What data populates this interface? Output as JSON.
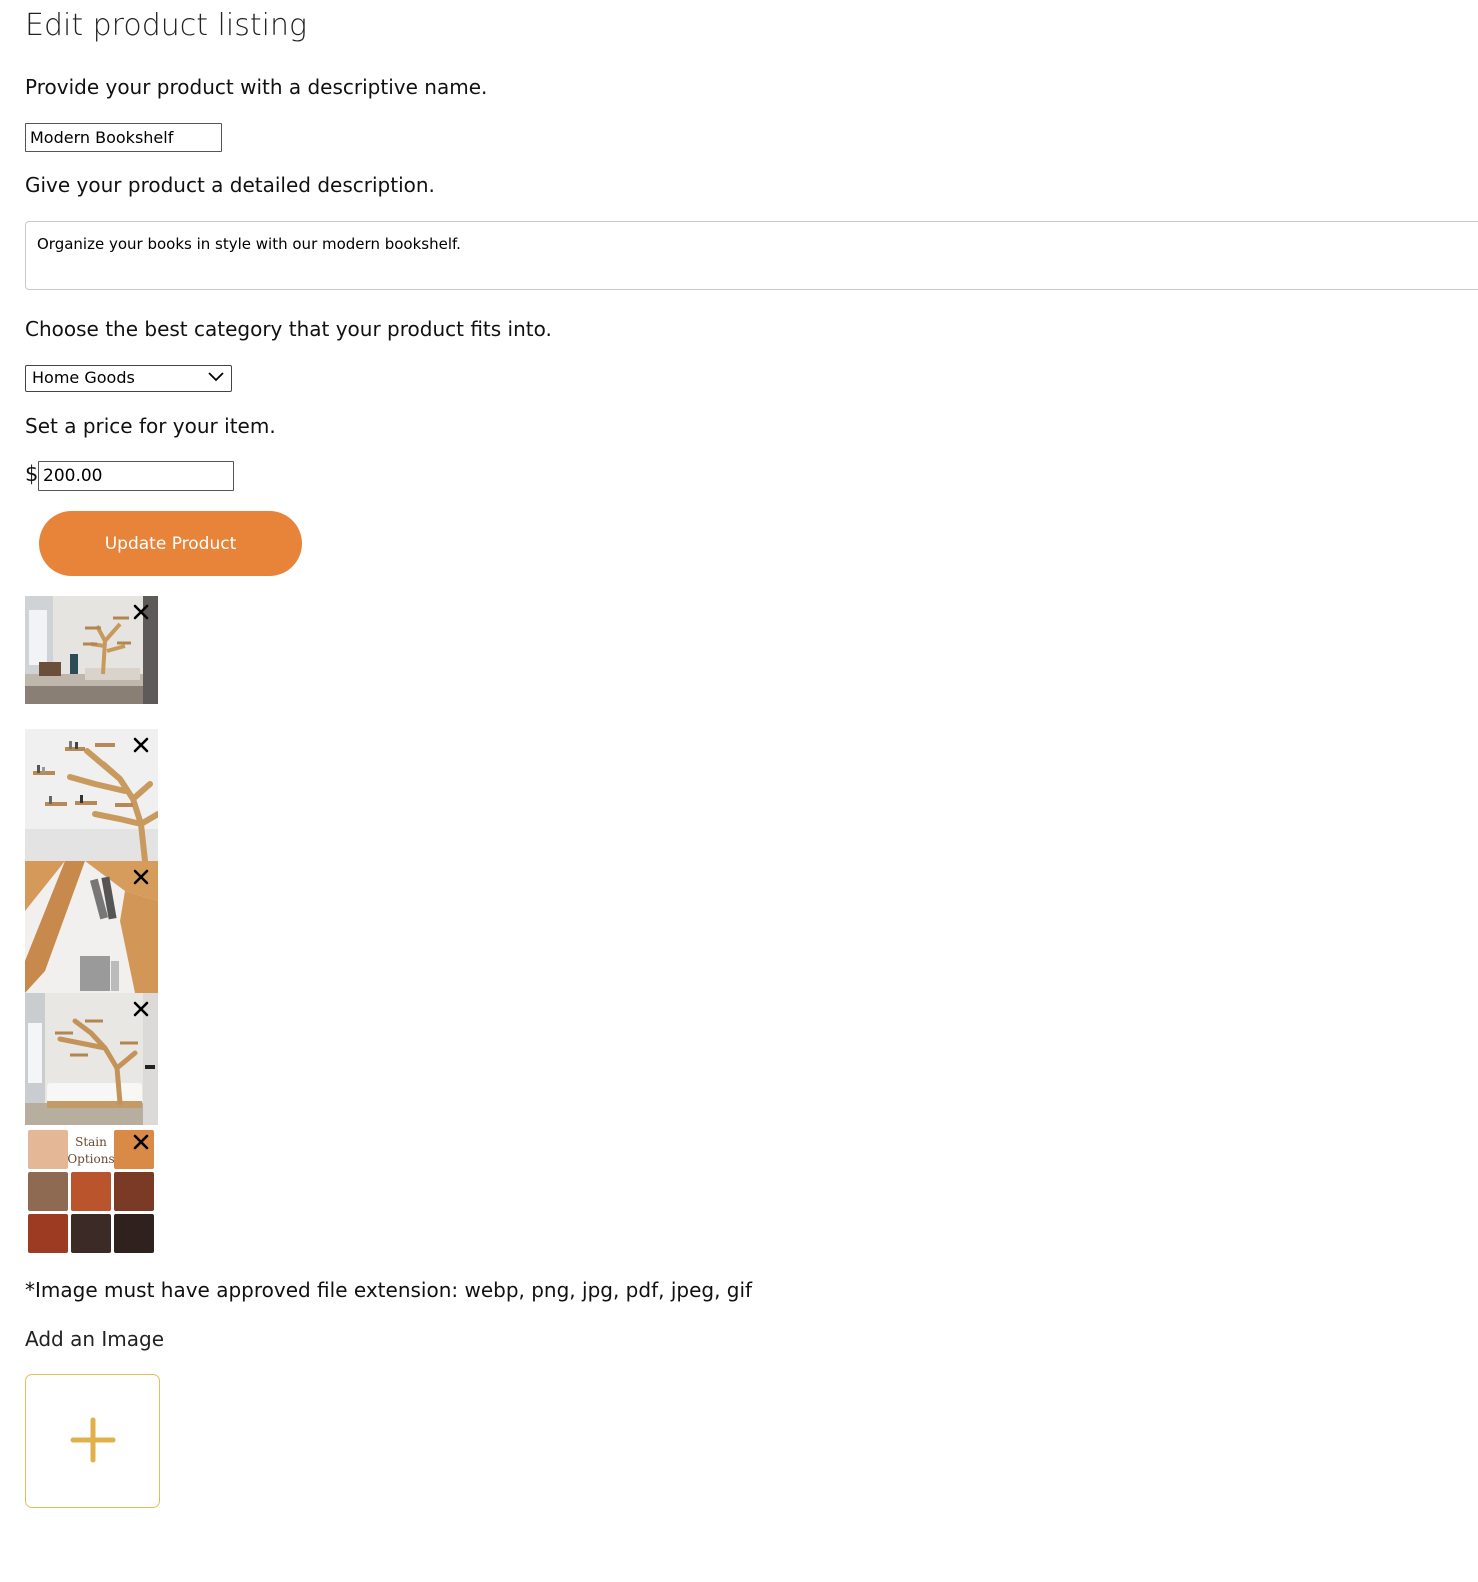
{
  "header": {
    "title": "Edit product listing"
  },
  "form": {
    "name_label": "Provide your product with a descriptive name.",
    "name_value": "Modern Bookshelf",
    "description_label": "Give your product a detailed description.",
    "description_value": "Organize your books in style with our modern bookshelf.",
    "category_label": "Choose the best category that your product fits into.",
    "category_value": "Home Goods",
    "price_label": "Set a price for your item.",
    "currency_symbol": "$",
    "price_value": "200.00",
    "update_button_label": "Update Product"
  },
  "images": {
    "items": [
      {
        "subject": "room-with-tree-bookshelf"
      },
      {
        "subject": "tree-bookshelf-closeup"
      },
      {
        "subject": "bookshelf-shelves-detail"
      },
      {
        "subject": "living-room-tree-bookshelf"
      },
      {
        "subject": "stain-options-swatches",
        "caption_line1": "Stain",
        "caption_line2": "Options"
      }
    ],
    "remove_icon": "close-icon",
    "note": "*Image must have approved file extension: webp, png, jpg, pdf, jpeg, gif",
    "add_label": "Add an Image",
    "add_icon": "plus-icon"
  },
  "colors": {
    "accent": "#e8833a",
    "add_border": "#e7be56",
    "plus": "#e0b04a"
  }
}
